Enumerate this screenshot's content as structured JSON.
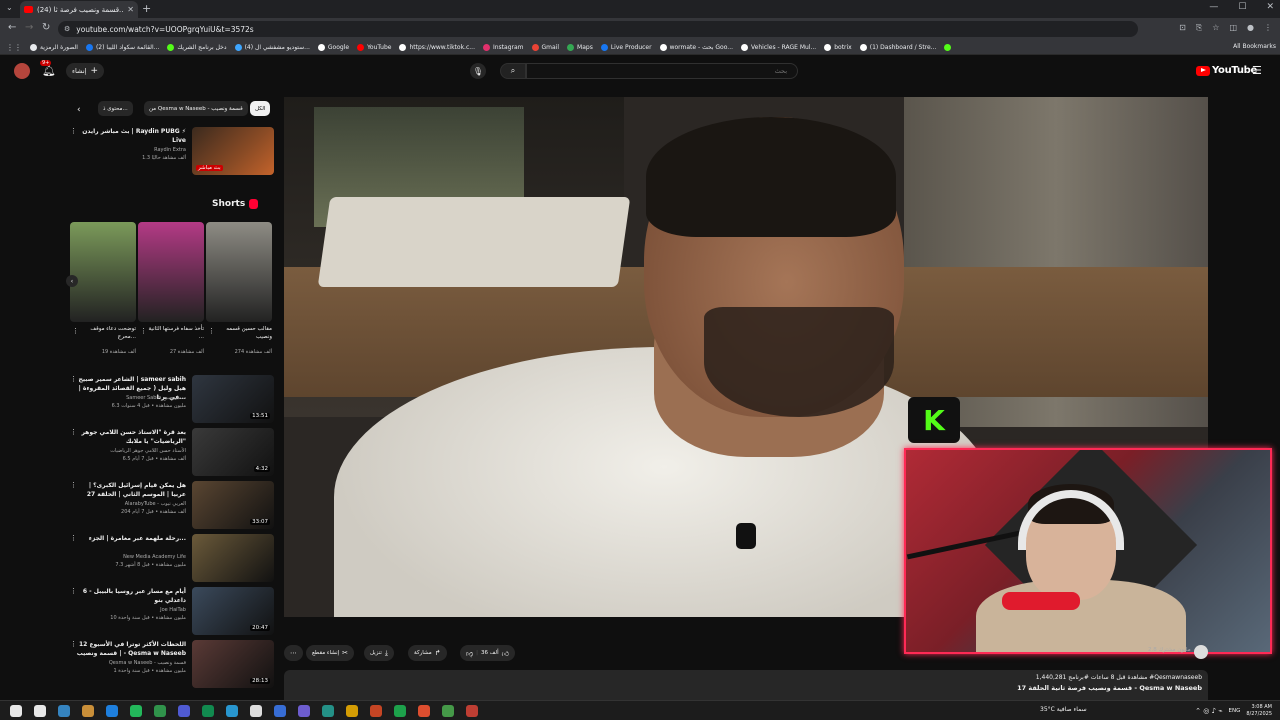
{
  "browser": {
    "tab_title": "(24) قسمة ونصيب فرصة ثا...",
    "url": "youtube.com/watch?v=UOOPgrqYuiU&t=3572s",
    "bookmarks": [
      {
        "label": "الصورة الرمزية",
        "color": "#e8eaed"
      },
      {
        "label": "(2) القائمة سكواد الليبا...",
        "color": "#1877f2"
      },
      {
        "label": "دخل برنامج الشريك",
        "color": "#53fc18"
      },
      {
        "label": "(4) ستوديو مشفشي ال...",
        "color": "#3ea6ff"
      },
      {
        "label": "Google",
        "color": "#ffffff"
      },
      {
        "label": "YouTube",
        "color": "#ff0000"
      },
      {
        "label": "https://www.tiktok.c...",
        "color": "#ffffff"
      },
      {
        "label": "Instagram",
        "color": "#e1306c"
      },
      {
        "label": "Gmail",
        "color": "#ea4335"
      },
      {
        "label": "Maps",
        "color": "#34a853"
      },
      {
        "label": "Live Producer",
        "color": "#1877f2"
      },
      {
        "label": "wormate - بحث Goo...",
        "color": "#ffffff"
      },
      {
        "label": "Vehicles - RAGE Mul...",
        "color": "#ffffff"
      },
      {
        "label": "botrix",
        "color": "#ffffff"
      },
      {
        "label": "(1) Dashboard / Stre...",
        "color": "#ffffff"
      },
      {
        "label": "",
        "color": "#53fc18"
      }
    ],
    "all_bookmarks": "All Bookmarks"
  },
  "header": {
    "create_label": "إنشاء",
    "notif_count": "9+",
    "search_placeholder": "بحث",
    "logo_word": "YouTube"
  },
  "chips": [
    {
      "label": "الكل",
      "active": true
    },
    {
      "label": "من Qesma w Naseeb - قسمة ونصيب",
      "active": false
    },
    {
      "label": "محتوى ذ...",
      "active": false
    }
  ],
  "top_video": {
    "title": "بث مباشر رايدن | Raydin PUBG ⚡ Live",
    "channel": "Raydin Extra",
    "meta": "1.3 ألف مشاهد حاليًا",
    "badge": "بث مباشر"
  },
  "shorts": {
    "label": "Shorts",
    "items": [
      {
        "title": "مقالب حسين قسمه ونصيب",
        "views": "274 ألف مشاهدة",
        "color": "#8e8c84"
      },
      {
        "title": "تأخذ سفاه فرستها الثانية ...",
        "views": "27 ألف مشاهدة",
        "color": "#b43a86"
      },
      {
        "title": "توضحت دعاء موقف محرج...",
        "views": "19 ألف مشاهدة",
        "color": "#7b9a5a"
      }
    ]
  },
  "videos": [
    {
      "title": "الشاعر سمير صبيح | sameer sabih | هيل وليل ( جميع القصائد المقروءة في برنا...",
      "channel": "Sameer Sabih سمير صبيح",
      "meta": "6.3 مليون مشاهدة • قبل 4 سنوات",
      "duration": "13:51",
      "color": "#2f3640"
    },
    {
      "title": "بعد قرة \"الاستاذ حسن اللامي جوهر الرياضيات\" يا ملابك\"",
      "channel": "الأستاذ حسن اللامي جوهر الرياضيات",
      "meta": "6.5 ألف مشاهدة • قبل 7 أيام",
      "duration": "4:32",
      "color": "#3a3a3a"
    },
    {
      "title": "هل يمكن قيام إسرائيل الكبرى؟ | عربيا | الموسم الثاني | الحلقة 27",
      "channel": "AlarabyTube - العربي تيوب",
      "meta": "204 ألف مشاهدة • قبل 7 أيام",
      "duration": "33:07",
      "color": "#5a4632"
    },
    {
      "title": "رحلة ملهمة عبر مغامرة | الجزء...",
      "channel": "New Media Academy Life",
      "meta": "7.3 مليون مشاهدة • قبل 8 أشهر",
      "duration": "",
      "color": "#6b5a3a"
    },
    {
      "title": "6 أيام مع مسار عبر روسيا بالبيبل - داعدلي بنو",
      "channel": "Joe HaiTab",
      "meta": "10 مليون مشاهدة • قبل سنة واحدة",
      "duration": "20:47",
      "color": "#3b4a5c"
    },
    {
      "title": "اللحظات الأكثر توترا في الأسبوع 12 | قسمة ونصيب - Qesma w Naseeb",
      "channel": "Qesma w Naseeb - قسمة ونصيب",
      "meta": "1 مليون مشاهدة • قبل سنة واحدة",
      "duration": "28:13",
      "color": "#5a3a36"
    }
  ],
  "actions": {
    "likes": "36 ألف",
    "share": "مشاركة",
    "download": "تنزيل",
    "clip": "إنشاء مقطع",
    "channel_meta": "2.8 مليون مشترك"
  },
  "description": {
    "line1": "1,440,281 مشاهدة قبل 8 ساعات #برنامج #Qesmawnaseeb",
    "line2": "قسمة ونصيب فرصة ثانية الحلقة 17 - Qesma w Naseeb"
  },
  "taskbar": {
    "weather": "35°C سماء صافية",
    "lang": "ENG",
    "time": "3:08 AM",
    "date": "8/27/2025"
  },
  "kick_letter": "K"
}
